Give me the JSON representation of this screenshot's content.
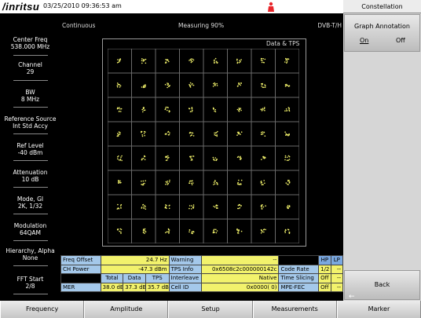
{
  "header": {
    "logo": "/inritsu",
    "datetime": "03/25/2010 09:36:53 am"
  },
  "status": {
    "mode": "Continuous",
    "measuring": "Measuring  90%",
    "standard": "DVB-T/H"
  },
  "left_panel": [
    {
      "label": "Center Freq",
      "value": "538.000 MHz"
    },
    {
      "label": "Channel",
      "value": "29"
    },
    {
      "label": "BW",
      "value": "8 MHz"
    },
    {
      "label": "Reference Source",
      "value": "Int Std Accy"
    },
    {
      "label": "Ref Level",
      "value": "-40 dBm"
    },
    {
      "label": "Attenuation",
      "value": "10 dB"
    },
    {
      "label": "Mode, GI",
      "value": "2K, 1/32"
    },
    {
      "label": "Modulation",
      "value": "64QAM"
    },
    {
      "label": "Hierarchy, Alpha",
      "value": "None"
    },
    {
      "label": "FFT Start",
      "value": "2/8"
    }
  ],
  "plot": {
    "title": "Data & TPS",
    "grid_rows": 8,
    "grid_cols": 8,
    "point_color": "#f2f26c",
    "grid_color": "#6a6a6a"
  },
  "table": {
    "freq_offset": {
      "label": "Freq Offset",
      "value": "24.7 Hz"
    },
    "ch_power": {
      "label": "CH Power",
      "value": "-47.3 dBm"
    },
    "mer_headers": [
      "Total",
      "Data",
      "TPS"
    ],
    "mer": {
      "label": "MER",
      "total": "38.0 dB",
      "data": "37.3 dB",
      "tps": "35.7 dB"
    },
    "warning": {
      "label": "Warning",
      "value": "--"
    },
    "tps_info": {
      "label": "TPS Info",
      "value": "0x6508c2c000000142c"
    },
    "interleave": {
      "label": "Interleave",
      "value": "Native"
    },
    "cell_id": {
      "label": "Cell ID",
      "value": "0x0000(     0)"
    },
    "hp_header": "HP",
    "lp_header": "LP",
    "code_rate": {
      "label": "Code Rate",
      "hp": "1/2",
      "lp": "--"
    },
    "time_slicing": {
      "label": "Time Slicing",
      "hp": "Off",
      "lp": "--"
    },
    "mpe_fec": {
      "label": "MPE-FEC",
      "hp": "Off",
      "lp": "--"
    }
  },
  "right_panel": {
    "title": "Constellation",
    "graph_annotation": "Graph Annotation",
    "on": "On",
    "off": "Off",
    "back": "Back",
    "back_arrow": "←"
  },
  "bottom_menu": [
    "Frequency",
    "Amplitude",
    "Setup",
    "Measurements",
    "Marker"
  ],
  "colors": {
    "table_label": "#a4c8ea",
    "table_value": "#f2f26c",
    "softkey": "#d6d6d6"
  }
}
